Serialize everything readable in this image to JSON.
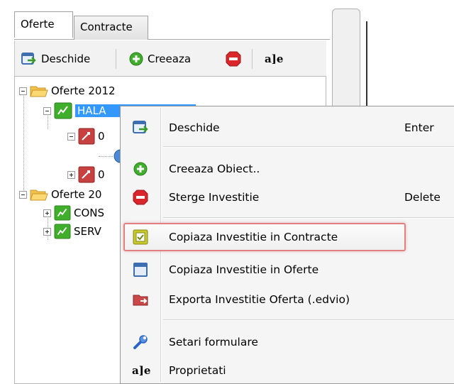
{
  "tabs": [
    {
      "label": "Oferte",
      "active": true
    },
    {
      "label": "Contracte",
      "active": false
    }
  ],
  "toolbar": {
    "open_label": "Deschide",
    "create_label": "Creeaza",
    "rename_icon_text": "a]e"
  },
  "tree": {
    "root1": "Oferte 2012",
    "child_selected": "HALA",
    "sub1": "0",
    "sub2": "0",
    "root2": "Oferte 20",
    "child3": "CONS",
    "child4": "SERV"
  },
  "menu": {
    "items": [
      {
        "label": "Deschide",
        "shortcut": "Enter",
        "icon": "open-icon"
      },
      {
        "label": "Creeaza Obiect..",
        "shortcut": "",
        "icon": "add-green-icon"
      },
      {
        "label": "Sterge Investitie",
        "shortcut": "Delete",
        "icon": "delete-red-icon"
      },
      {
        "label": "Copiaza Investitie in Contracte",
        "shortcut": "",
        "icon": "copy-to-contracts-icon",
        "highlighted": true
      },
      {
        "label": "Copiaza Investitie in Oferte",
        "shortcut": "",
        "icon": "copy-to-offers-icon"
      },
      {
        "label": "Exporta Investitie Oferta (.edvio)",
        "shortcut": "",
        "icon": "export-icon"
      },
      {
        "label": "Setari formulare",
        "shortcut": "",
        "icon": "wrench-icon"
      },
      {
        "label": "Proprietati",
        "shortcut": "",
        "icon": "properties-icon"
      }
    ],
    "properties_icon_text": "a]e"
  },
  "colors": {
    "selection": "#3399ff",
    "highlight_border": "#e08080",
    "green": "#3fae2a",
    "red": "#d9262a"
  }
}
